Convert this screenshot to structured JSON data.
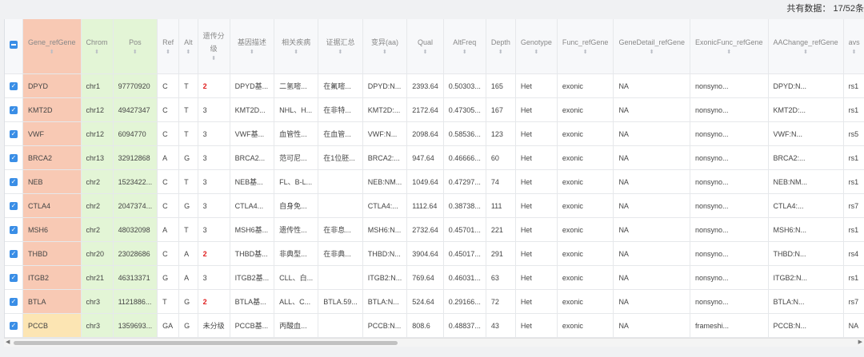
{
  "toolbar": {
    "count_text": "共有数据： 17/52条"
  },
  "columns": [
    {
      "key": "gene",
      "label": "Gene_refGene"
    },
    {
      "key": "chrom",
      "label": "Chrom"
    },
    {
      "key": "pos",
      "label": "Pos"
    },
    {
      "key": "ref",
      "label": "Ref"
    },
    {
      "key": "alt",
      "label": "Alt"
    },
    {
      "key": "grade",
      "label": "遗传分级"
    },
    {
      "key": "desc",
      "label": "基因描述"
    },
    {
      "key": "disease",
      "label": "相关疾病"
    },
    {
      "key": "evidence",
      "label": "证据汇总"
    },
    {
      "key": "mut",
      "label": "变异(aa)"
    },
    {
      "key": "qual",
      "label": "Qual"
    },
    {
      "key": "altfreq",
      "label": "AltFreq"
    },
    {
      "key": "depth",
      "label": "Depth"
    },
    {
      "key": "genotype",
      "label": "Genotype"
    },
    {
      "key": "func",
      "label": "Func_refGene"
    },
    {
      "key": "gdetail",
      "label": "GeneDetail_refGene"
    },
    {
      "key": "exfunc",
      "label": "ExonicFunc_refGene"
    },
    {
      "key": "aachange",
      "label": "AAChange_refGene"
    },
    {
      "key": "avs",
      "label": "avs"
    }
  ],
  "rows": [
    {
      "gene": "DPYD",
      "chrom": "chr1",
      "pos": "97770920",
      "ref": "C",
      "alt": "T",
      "grade": "2",
      "desc": "DPYD基...",
      "disease": "二氢嘧...",
      "evidence": "在氟嘧...",
      "mut": "DPYD:N...",
      "qual": "2393.64",
      "altfreq": "0.50303...",
      "depth": "165",
      "genotype": "Het",
      "func": "exonic",
      "gdetail": "NA",
      "exfunc": "nonsyno...",
      "aachange": "DPYD:N...",
      "avs": "rs1"
    },
    {
      "gene": "KMT2D",
      "chrom": "chr12",
      "pos": "49427347",
      "ref": "C",
      "alt": "T",
      "grade": "3",
      "desc": "KMT2D...",
      "disease": "NHL、H...",
      "evidence": "在非特...",
      "mut": "KMT2D:...",
      "qual": "2172.64",
      "altfreq": "0.47305...",
      "depth": "167",
      "genotype": "Het",
      "func": "exonic",
      "gdetail": "NA",
      "exfunc": "nonsyno...",
      "aachange": "KMT2D:...",
      "avs": "rs1"
    },
    {
      "gene": "VWF",
      "chrom": "chr12",
      "pos": "6094770",
      "ref": "C",
      "alt": "T",
      "grade": "3",
      "desc": "VWF基...",
      "disease": "血管性...",
      "evidence": "在血管...",
      "mut": "VWF:N...",
      "qual": "2098.64",
      "altfreq": "0.58536...",
      "depth": "123",
      "genotype": "Het",
      "func": "exonic",
      "gdetail": "NA",
      "exfunc": "nonsyno...",
      "aachange": "VWF:N...",
      "avs": "rs5"
    },
    {
      "gene": "BRCA2",
      "chrom": "chr13",
      "pos": "32912868",
      "ref": "A",
      "alt": "G",
      "grade": "3",
      "desc": "BRCA2...",
      "disease": "范可尼...",
      "evidence": "在1位胚...",
      "mut": "BRCA2:...",
      "qual": "947.64",
      "altfreq": "0.46666...",
      "depth": "60",
      "genotype": "Het",
      "func": "exonic",
      "gdetail": "NA",
      "exfunc": "nonsyno...",
      "aachange": "BRCA2:...",
      "avs": "rs1"
    },
    {
      "gene": "NEB",
      "chrom": "chr2",
      "pos": "1523422...",
      "ref": "C",
      "alt": "T",
      "grade": "3",
      "desc": "NEB基...",
      "disease": "FL、B-L...",
      "evidence": "",
      "mut": "NEB:NM...",
      "qual": "1049.64",
      "altfreq": "0.47297...",
      "depth": "74",
      "genotype": "Het",
      "func": "exonic",
      "gdetail": "NA",
      "exfunc": "nonsyno...",
      "aachange": "NEB:NM...",
      "avs": "rs1"
    },
    {
      "gene": "CTLA4",
      "chrom": "chr2",
      "pos": "2047374...",
      "ref": "C",
      "alt": "G",
      "grade": "3",
      "desc": "CTLA4...",
      "disease": "自身免...",
      "evidence": "",
      "mut": "CTLA4:...",
      "qual": "1112.64",
      "altfreq": "0.38738...",
      "depth": "111",
      "genotype": "Het",
      "func": "exonic",
      "gdetail": "NA",
      "exfunc": "nonsyno...",
      "aachange": "CTLA4:...",
      "avs": "rs7"
    },
    {
      "gene": "MSH6",
      "chrom": "chr2",
      "pos": "48032098",
      "ref": "A",
      "alt": "T",
      "grade": "3",
      "desc": "MSH6基...",
      "disease": "遗传性...",
      "evidence": "在非息...",
      "mut": "MSH6:N...",
      "qual": "2732.64",
      "altfreq": "0.45701...",
      "depth": "221",
      "genotype": "Het",
      "func": "exonic",
      "gdetail": "NA",
      "exfunc": "nonsyno...",
      "aachange": "MSH6:N...",
      "avs": "rs1"
    },
    {
      "gene": "THBD",
      "chrom": "chr20",
      "pos": "23028686",
      "ref": "C",
      "alt": "A",
      "grade": "2",
      "desc": "THBD基...",
      "disease": "非典型...",
      "evidence": "在非典...",
      "mut": "THBD:N...",
      "qual": "3904.64",
      "altfreq": "0.45017...",
      "depth": "291",
      "genotype": "Het",
      "func": "exonic",
      "gdetail": "NA",
      "exfunc": "nonsyno...",
      "aachange": "THBD:N...",
      "avs": "rs4"
    },
    {
      "gene": "ITGB2",
      "chrom": "chr21",
      "pos": "46313371",
      "ref": "G",
      "alt": "A",
      "grade": "3",
      "desc": "ITGB2基...",
      "disease": "CLL、白...",
      "evidence": "",
      "mut": "ITGB2:N...",
      "qual": "769.64",
      "altfreq": "0.46031...",
      "depth": "63",
      "genotype": "Het",
      "func": "exonic",
      "gdetail": "NA",
      "exfunc": "nonsyno...",
      "aachange": "ITGB2:N...",
      "avs": "rs1"
    },
    {
      "gene": "BTLA",
      "chrom": "chr3",
      "pos": "1121886...",
      "ref": "T",
      "alt": "G",
      "grade": "2",
      "desc": "BTLA基...",
      "disease": "ALL、C...",
      "evidence": "BTLA.59...",
      "mut": "BTLA:N...",
      "qual": "524.64",
      "altfreq": "0.29166...",
      "depth": "72",
      "genotype": "Het",
      "func": "exonic",
      "gdetail": "NA",
      "exfunc": "nonsyno...",
      "aachange": "BTLA:N...",
      "avs": "rs7"
    },
    {
      "gene": "PCCB",
      "chrom": "chr3",
      "pos": "1359693...",
      "ref": "GA",
      "alt": "G",
      "grade": "未分级",
      "desc": "PCCB基...",
      "disease": "丙酸血...",
      "evidence": "",
      "mut": "PCCB:N...",
      "qual": "808.6",
      "altfreq": "0.48837...",
      "depth": "43",
      "genotype": "Het",
      "func": "exonic",
      "gdetail": "NA",
      "exfunc": "frameshi...",
      "aachange": "PCCB:N...",
      "avs": "NA"
    }
  ],
  "style": {
    "checkbox_color": "#3a8ee6",
    "gene_bg": "#f8c9b4",
    "gene_last_bg": "#fce5b3",
    "pos_bg": "#e3f5d6",
    "grade_highlight": "#e02020"
  }
}
